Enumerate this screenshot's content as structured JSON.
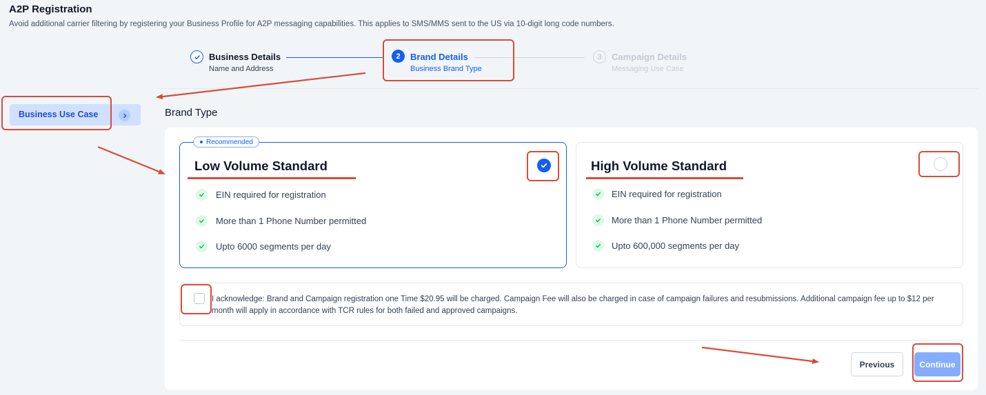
{
  "page": {
    "title": "A2P Registration",
    "subtitle": "Avoid additional carrier filtering by registering your Business Profile for A2P messaging capabilities. This applies to SMS/MMS sent to the US via 10-digit long code numbers."
  },
  "stepper": {
    "steps": [
      {
        "number": "1",
        "title": "Business Details",
        "description": "Name and Address",
        "status": "completed",
        "icon": "check-icon"
      },
      {
        "number": "2",
        "title": "Brand Details",
        "description": "Business Brand Type",
        "status": "active"
      },
      {
        "number": "3",
        "title": "Campaign Details",
        "description": "Messaging Use Case",
        "status": "upcoming"
      }
    ]
  },
  "sidebar": {
    "items": [
      {
        "label": "Business Use Case",
        "icon": "chevron-right-icon",
        "active": true
      }
    ]
  },
  "brand_type": {
    "section_title": "Brand Type",
    "options": [
      {
        "badge": "Recommended",
        "title": "Low Volume Standard",
        "selected": true,
        "features": [
          "EIN required for registration",
          "More than 1 Phone Number permitted",
          "Upto 6000 segments per day"
        ]
      },
      {
        "title": "High Volume Standard",
        "selected": false,
        "features": [
          "EIN required for registration",
          "More than 1 Phone Number permitted",
          "Upto 600,000 segments per day"
        ]
      }
    ]
  },
  "acknowledgement": {
    "checked": false,
    "text": "I acknowledge: Brand and Campaign registration one Time $20.95 will be charged. Campaign Fee will also be charged in case of campaign failures and resubmissions. Additional campaign fee up to $12 per month will apply in accordance with TCR rules for both failed and approved campaigns."
  },
  "footer": {
    "previous_label": "Previous",
    "continue_label": "Continue"
  },
  "colors": {
    "primary": "#155eef",
    "primary_disabled": "#84adff",
    "success_bg": "#dcfae6",
    "success": "#17b26a",
    "annotation": "#d94a3a"
  }
}
